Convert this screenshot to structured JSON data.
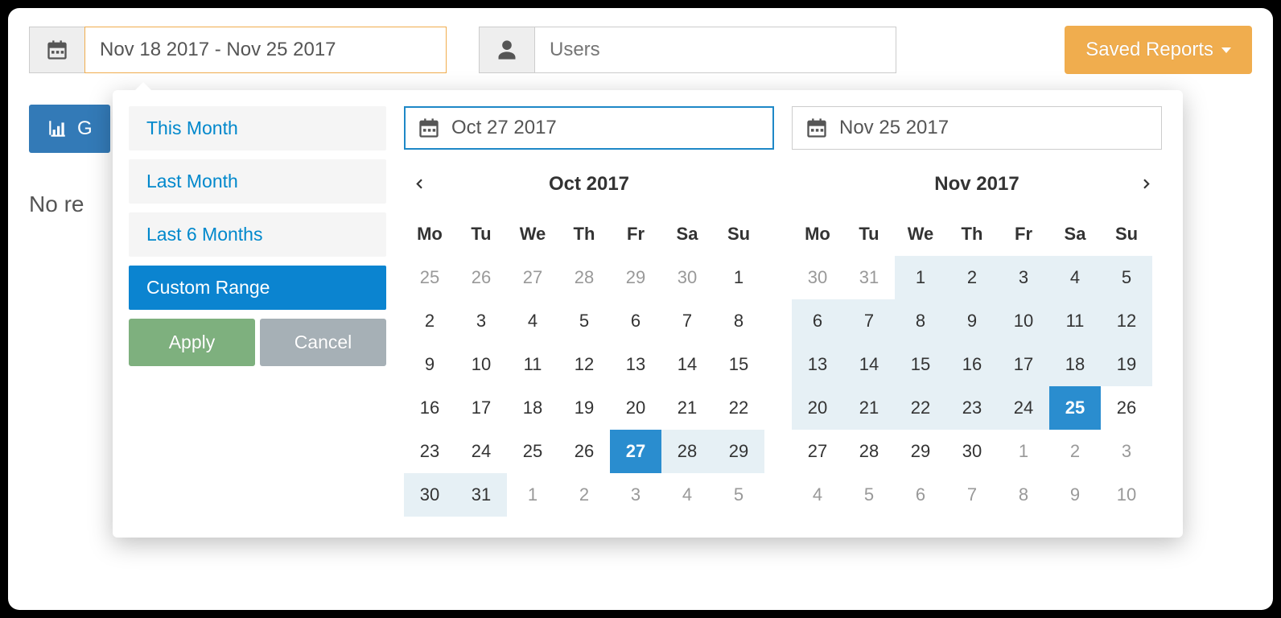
{
  "topbar": {
    "date_range_value": "Nov 18 2017 - Nov 25 2017",
    "users_placeholder": "Users",
    "saved_reports_label": "Saved Reports"
  },
  "background": {
    "button_fragment": "G",
    "no_results_fragment": "No re"
  },
  "picker": {
    "presets": {
      "this_month": "This Month",
      "last_month": "Last Month",
      "last_6_months": "Last 6 Months",
      "custom_range": "Custom Range"
    },
    "apply_label": "Apply",
    "cancel_label": "Cancel",
    "start": {
      "value": "Oct 27 2017",
      "title": "Oct 2017",
      "dow": {
        "mo": "Mo",
        "tu": "Tu",
        "we": "We",
        "th": "Th",
        "fr": "Fr",
        "sa": "Sa",
        "su": "Su"
      },
      "days": [
        {
          "n": "25",
          "state": "off"
        },
        {
          "n": "26",
          "state": "off"
        },
        {
          "n": "27",
          "state": "off"
        },
        {
          "n": "28",
          "state": "off"
        },
        {
          "n": "29",
          "state": "off"
        },
        {
          "n": "30",
          "state": "off"
        },
        {
          "n": "1",
          "state": ""
        },
        {
          "n": "2",
          "state": ""
        },
        {
          "n": "3",
          "state": ""
        },
        {
          "n": "4",
          "state": ""
        },
        {
          "n": "5",
          "state": ""
        },
        {
          "n": "6",
          "state": ""
        },
        {
          "n": "7",
          "state": ""
        },
        {
          "n": "8",
          "state": ""
        },
        {
          "n": "9",
          "state": ""
        },
        {
          "n": "10",
          "state": ""
        },
        {
          "n": "11",
          "state": ""
        },
        {
          "n": "12",
          "state": ""
        },
        {
          "n": "13",
          "state": ""
        },
        {
          "n": "14",
          "state": ""
        },
        {
          "n": "15",
          "state": ""
        },
        {
          "n": "16",
          "state": ""
        },
        {
          "n": "17",
          "state": ""
        },
        {
          "n": "18",
          "state": ""
        },
        {
          "n": "19",
          "state": ""
        },
        {
          "n": "20",
          "state": ""
        },
        {
          "n": "21",
          "state": ""
        },
        {
          "n": "22",
          "state": ""
        },
        {
          "n": "23",
          "state": ""
        },
        {
          "n": "24",
          "state": ""
        },
        {
          "n": "25",
          "state": ""
        },
        {
          "n": "26",
          "state": ""
        },
        {
          "n": "27",
          "state": "active"
        },
        {
          "n": "28",
          "state": "inrange"
        },
        {
          "n": "29",
          "state": "inrange"
        },
        {
          "n": "30",
          "state": "inrange"
        },
        {
          "n": "31",
          "state": "inrange"
        },
        {
          "n": "1",
          "state": "off"
        },
        {
          "n": "2",
          "state": "off"
        },
        {
          "n": "3",
          "state": "off"
        },
        {
          "n": "4",
          "state": "off"
        },
        {
          "n": "5",
          "state": "off"
        }
      ]
    },
    "end": {
      "value": "Nov 25 2017",
      "title": "Nov 2017",
      "dow": {
        "mo": "Mo",
        "tu": "Tu",
        "we": "We",
        "th": "Th",
        "fr": "Fr",
        "sa": "Sa",
        "su": "Su"
      },
      "days": [
        {
          "n": "30",
          "state": "off"
        },
        {
          "n": "31",
          "state": "off"
        },
        {
          "n": "1",
          "state": "inrange"
        },
        {
          "n": "2",
          "state": "inrange"
        },
        {
          "n": "3",
          "state": "inrange"
        },
        {
          "n": "4",
          "state": "inrange"
        },
        {
          "n": "5",
          "state": "inrange"
        },
        {
          "n": "6",
          "state": "inrange"
        },
        {
          "n": "7",
          "state": "inrange"
        },
        {
          "n": "8",
          "state": "inrange"
        },
        {
          "n": "9",
          "state": "inrange"
        },
        {
          "n": "10",
          "state": "inrange"
        },
        {
          "n": "11",
          "state": "inrange"
        },
        {
          "n": "12",
          "state": "inrange"
        },
        {
          "n": "13",
          "state": "inrange"
        },
        {
          "n": "14",
          "state": "inrange"
        },
        {
          "n": "15",
          "state": "inrange"
        },
        {
          "n": "16",
          "state": "inrange"
        },
        {
          "n": "17",
          "state": "inrange"
        },
        {
          "n": "18",
          "state": "inrange"
        },
        {
          "n": "19",
          "state": "inrange"
        },
        {
          "n": "20",
          "state": "inrange"
        },
        {
          "n": "21",
          "state": "inrange"
        },
        {
          "n": "22",
          "state": "inrange"
        },
        {
          "n": "23",
          "state": "inrange"
        },
        {
          "n": "24",
          "state": "inrange"
        },
        {
          "n": "25",
          "state": "active"
        },
        {
          "n": "26",
          "state": ""
        },
        {
          "n": "27",
          "state": ""
        },
        {
          "n": "28",
          "state": ""
        },
        {
          "n": "29",
          "state": ""
        },
        {
          "n": "30",
          "state": ""
        },
        {
          "n": "1",
          "state": "off"
        },
        {
          "n": "2",
          "state": "off"
        },
        {
          "n": "3",
          "state": "off"
        },
        {
          "n": "4",
          "state": "off"
        },
        {
          "n": "5",
          "state": "off"
        },
        {
          "n": "6",
          "state": "off"
        },
        {
          "n": "7",
          "state": "off"
        },
        {
          "n": "8",
          "state": "off"
        },
        {
          "n": "9",
          "state": "off"
        },
        {
          "n": "10",
          "state": "off"
        }
      ]
    }
  }
}
